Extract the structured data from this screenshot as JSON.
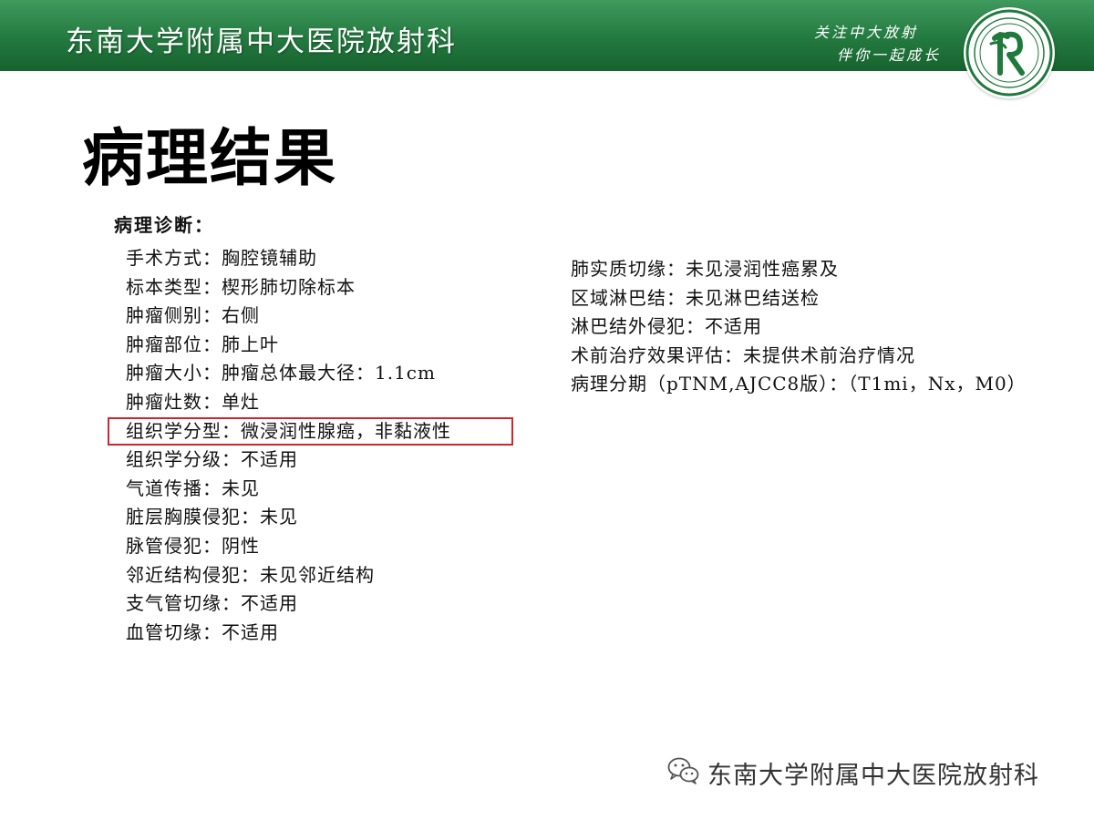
{
  "header": {
    "title": "东南大学附属中大医院放射科",
    "slogan_line1": "关注中大放射",
    "slogan_line2": "伴你一起成长",
    "colors": {
      "bar": "#23793f",
      "logo_green": "#1f7a3c"
    }
  },
  "slide": {
    "title": "病理结果",
    "diagnosis_heading": "病理诊断：",
    "left_items": [
      "手术方式：胸腔镜辅助",
      "标本类型：楔形肺切除标本",
      "肿瘤侧别：右侧",
      "肿瘤部位：肺上叶",
      "肿瘤大小：肿瘤总体最大径：1.1cm",
      "肿瘤灶数：单灶",
      "组织学分型：微浸润性腺癌，非黏液性",
      "组织学分级：不适用",
      "气道传播：未见",
      "脏层胸膜侵犯：未见",
      "脉管侵犯：阴性",
      "邻近结构侵犯：未见邻近结构",
      "支气管切缘：不适用",
      "血管切缘：不适用"
    ],
    "right_items": [
      "肺实质切缘：未见浸润性癌累及",
      "区域淋巴结：未见淋巴结送检",
      "淋巴结外侵犯：不适用",
      "术前治疗效果评估：未提供术前治疗情况",
      "病理分期（pTNM,AJCC8版）：（T1mi，Nx，M0）"
    ],
    "highlight_color": "#d0262b"
  },
  "footer": {
    "icon": "wechat-icon",
    "text": "东南大学附属中大医院放射科"
  }
}
